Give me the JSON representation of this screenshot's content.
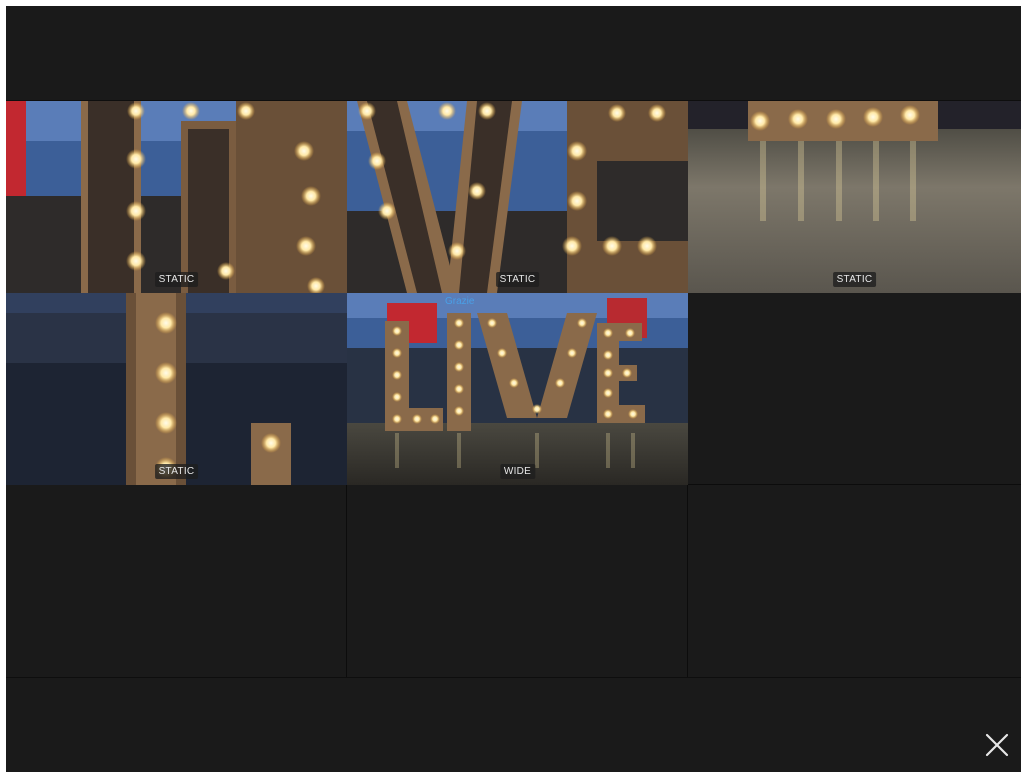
{
  "cameras": [
    {
      "mode": "STATIC"
    },
    {
      "mode": "STATIC"
    },
    {
      "mode": "STATIC"
    },
    {
      "mode": "STATIC"
    },
    {
      "mode": "WIDE",
      "name": "Grazie",
      "selected": true
    }
  ],
  "icons": {
    "close": "close-icon"
  },
  "colors": {
    "background": "#1a1a1a",
    "selection": "#3d8fd8",
    "camera_name": "#4a9fe6",
    "badge_text": "#e8e8e8"
  }
}
